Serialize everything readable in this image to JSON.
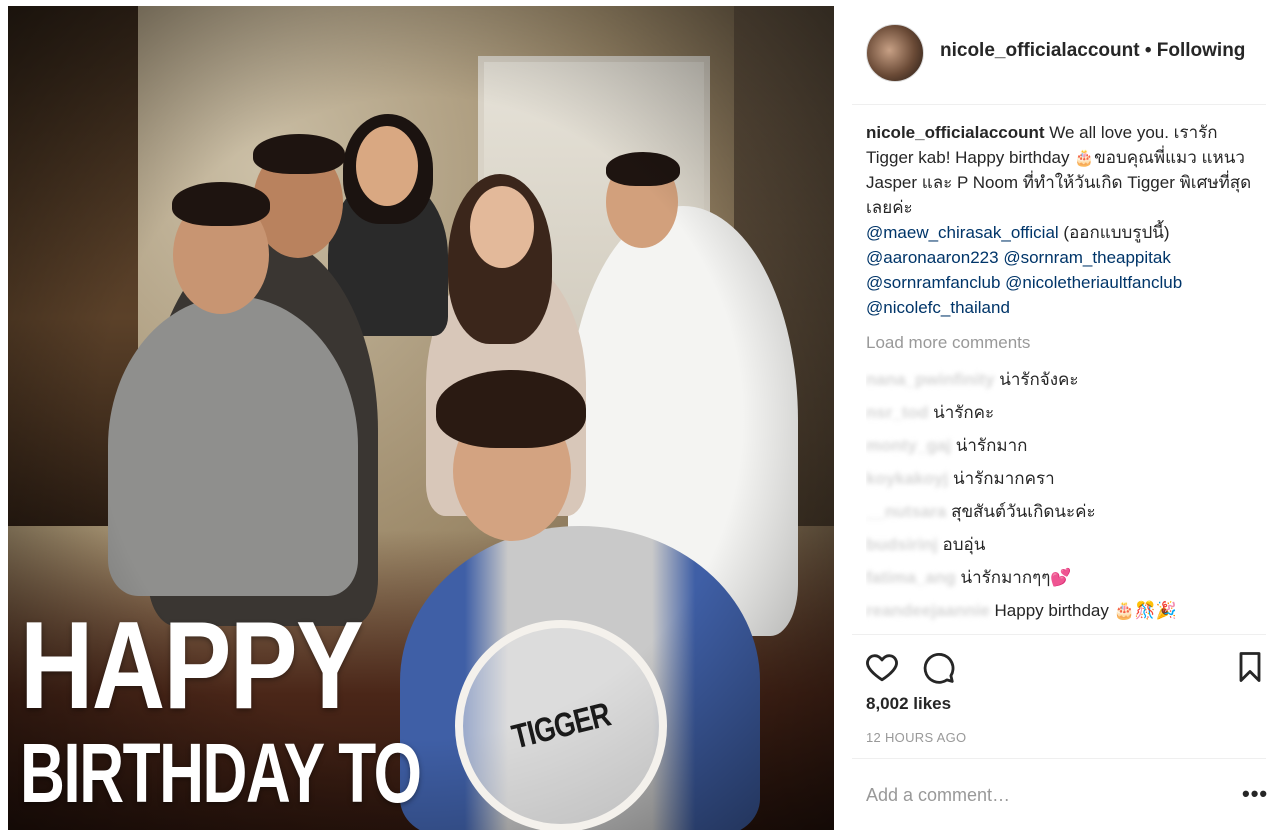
{
  "header": {
    "username": "nicole_officialaccount",
    "separator": "•",
    "follow_status": "Following"
  },
  "caption": {
    "username": "nicole_officialaccount",
    "text_part1": " We all love you. เรารัก Tigger kab! Happy birthday ",
    "emoji": "🎂",
    "text_part2": "ขอบคุณพี่แมว แหนว Jasper และ P Noom ที่ทำให้วันเกิด Tigger พิเศษที่สุดเลยค่ะ ",
    "mention1": "@maew_chirasak_official",
    "paren_text": " (ออกแบบรูปนี้) ",
    "mention2": "@aaronaaron223",
    "mention3": "@sornram_theappitak",
    "mention4": "@sornramfanclub",
    "mention5": "@nicoletheriaultfanclub",
    "mention6": "@nicolefc_thailand"
  },
  "load_more": "Load more comments",
  "comments": [
    {
      "user": "nana_pwinfinity",
      "text": "น่ารักจังคะ"
    },
    {
      "user": "nsr_tod",
      "text": "น่ารักคะ"
    },
    {
      "user": "monty_gaj",
      "text": "น่ารักมาก"
    },
    {
      "user": "koykakoyj",
      "text": "น่ารักมากครา"
    },
    {
      "user": "__nutsara",
      "text": "สุขสันต์วันเกิดนะค่ะ"
    },
    {
      "user": "budsirinj",
      "text": "อบอุ่น"
    },
    {
      "user": "fatima_ang",
      "text": "น่ารักมากๆๆ💕"
    },
    {
      "user": "reandeejaannie",
      "text": "Happy birthday 🎂🎊🎉"
    }
  ],
  "likes": "8,002 likes",
  "timestamp": "12 HOURS AGO",
  "add_comment": {
    "placeholder": "Add a comment…"
  },
  "more_options": "•••",
  "photo_text": {
    "happy": "HAPPY",
    "birthday_to": "BIRTHDAY TO",
    "name": "TIGGER"
  },
  "icons": {
    "like": "heart-icon",
    "comment": "comment-bubble-icon",
    "save": "bookmark-icon"
  }
}
